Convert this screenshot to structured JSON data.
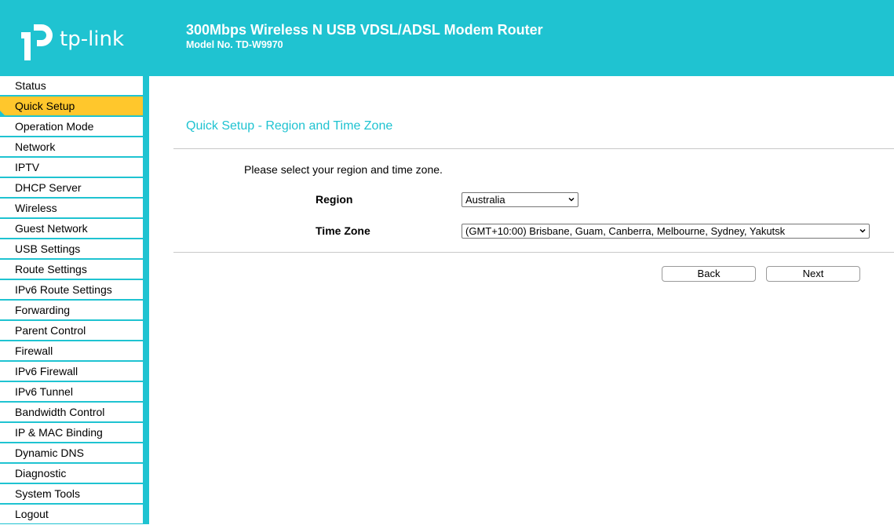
{
  "header": {
    "logo_text": "tp-link",
    "product_title": "300Mbps Wireless N USB VDSL/ADSL Modem Router",
    "model_no": "Model No. TD-W9970"
  },
  "sidebar": {
    "items": [
      {
        "label": "Status"
      },
      {
        "label": "Quick Setup",
        "active": true
      },
      {
        "label": "Operation Mode"
      },
      {
        "label": "Network"
      },
      {
        "label": "IPTV"
      },
      {
        "label": "DHCP Server"
      },
      {
        "label": "Wireless"
      },
      {
        "label": "Guest Network"
      },
      {
        "label": "USB Settings"
      },
      {
        "label": "Route Settings"
      },
      {
        "label": "IPv6 Route Settings"
      },
      {
        "label": "Forwarding"
      },
      {
        "label": "Parent Control"
      },
      {
        "label": "Firewall"
      },
      {
        "label": "IPv6 Firewall"
      },
      {
        "label": "IPv6 Tunnel"
      },
      {
        "label": "Bandwidth Control"
      },
      {
        "label": "IP & MAC Binding"
      },
      {
        "label": "Dynamic DNS"
      },
      {
        "label": "Diagnostic"
      },
      {
        "label": "System Tools"
      },
      {
        "label": "Logout"
      }
    ]
  },
  "main": {
    "page_title": "Quick Setup - Region and Time Zone",
    "instructions": "Please select your region and time zone.",
    "region_label": "Region",
    "region_value": "Australia",
    "timezone_label": "Time Zone",
    "timezone_value": "(GMT+10:00) Brisbane, Guam, Canberra, Melbourne, Sydney, Yakutsk",
    "back_label": "Back",
    "next_label": "Next"
  },
  "colors": {
    "brand": "#1fc3d1",
    "active_menu": "#ffc72c"
  },
  "icons": {
    "logo": "tp-link-logo-icon",
    "dropdown": "chevron-down-icon"
  }
}
